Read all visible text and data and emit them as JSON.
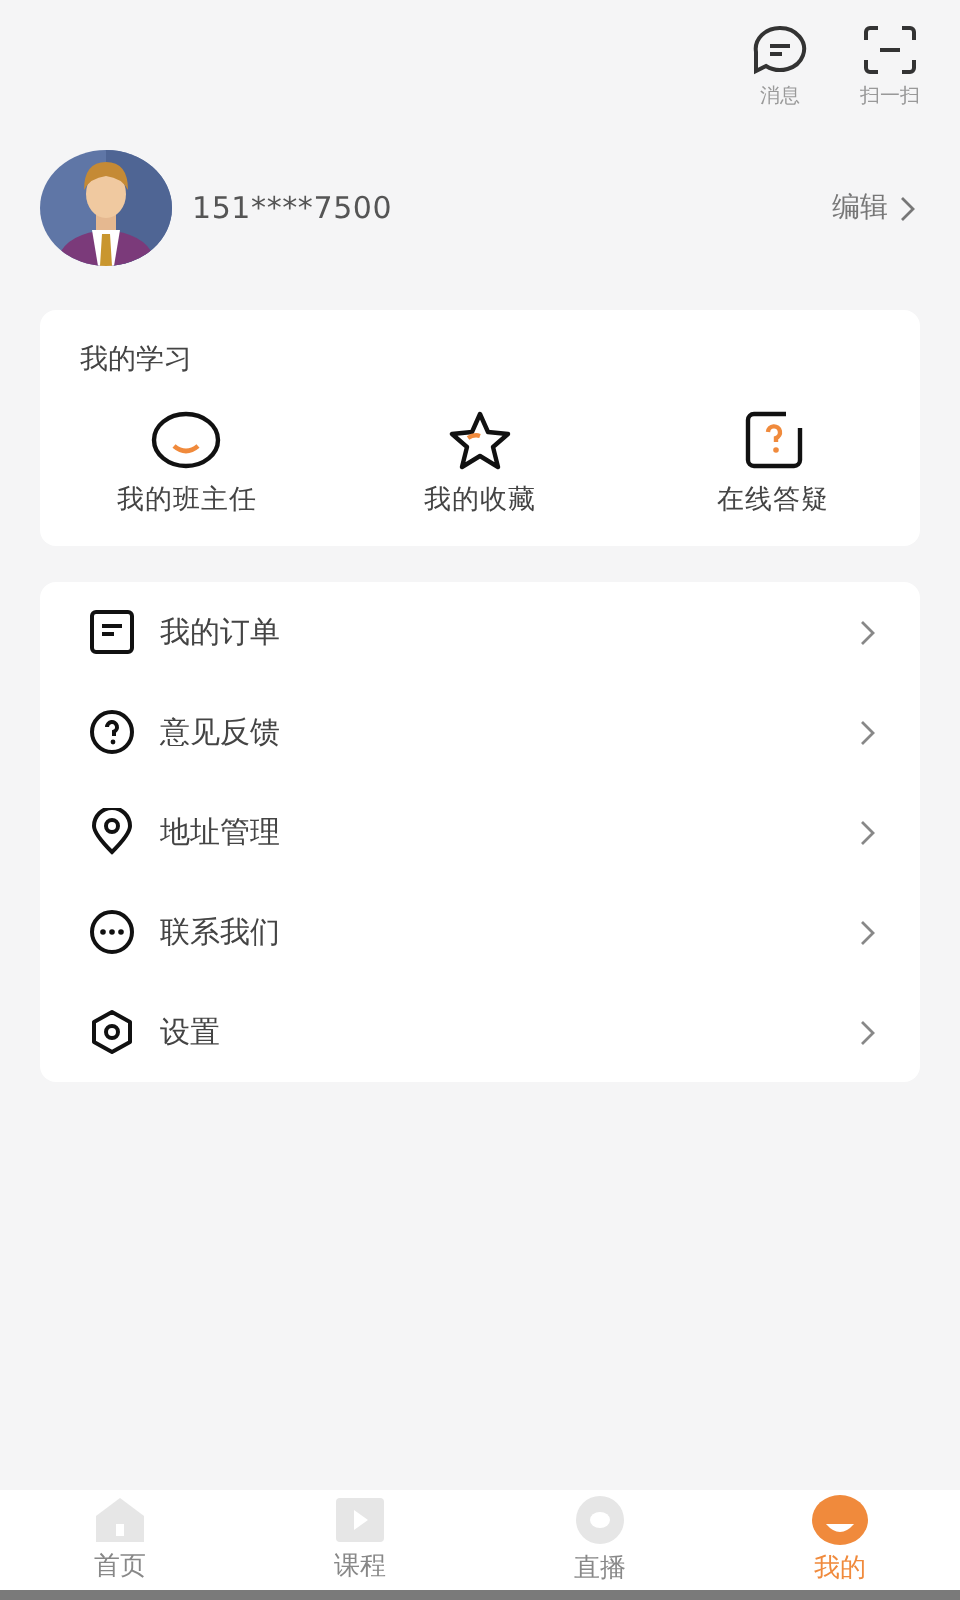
{
  "top_actions": [
    {
      "kind": "message",
      "label": "消息"
    },
    {
      "kind": "scan",
      "label": "扫一扫"
    }
  ],
  "profile": {
    "phone": "151****7500",
    "edit": "编辑"
  },
  "study": {
    "title": "我的学习",
    "items": [
      {
        "kind": "teacher",
        "label": "我的班主任"
      },
      {
        "kind": "favorites",
        "label": "我的收藏"
      },
      {
        "kind": "qa",
        "label": "在线答疑"
      }
    ]
  },
  "menu": [
    {
      "kind": "orders",
      "label": "我的订单"
    },
    {
      "kind": "feedback",
      "label": "意见反馈"
    },
    {
      "kind": "address",
      "label": "地址管理"
    },
    {
      "kind": "contact",
      "label": "联系我们"
    },
    {
      "kind": "settings",
      "label": "设置"
    }
  ],
  "tabs": [
    {
      "kind": "home",
      "label": "首页",
      "selected": false
    },
    {
      "kind": "course",
      "label": "课程",
      "selected": false
    },
    {
      "kind": "live",
      "label": "直播",
      "selected": false
    },
    {
      "kind": "mine",
      "label": "我的",
      "selected": true
    }
  ]
}
